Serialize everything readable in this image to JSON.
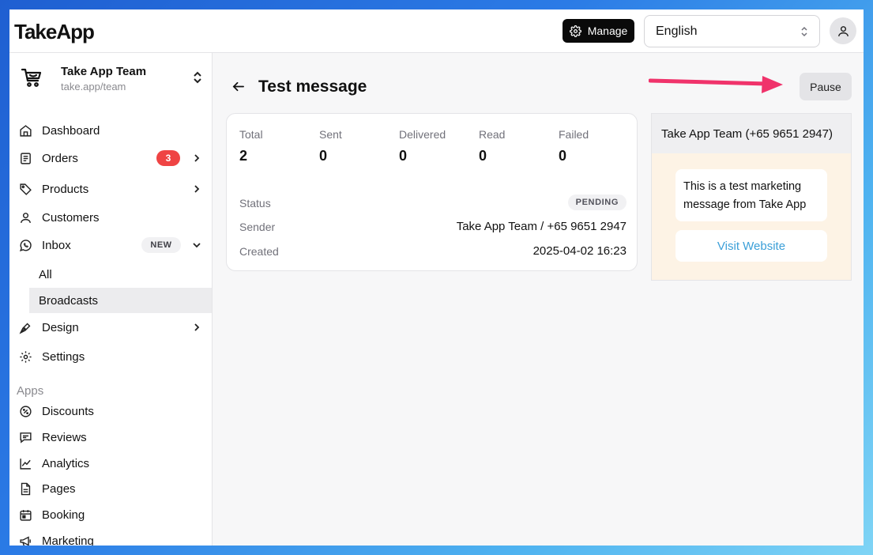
{
  "header": {
    "logo": "TakeApp",
    "manage_label": "Manage",
    "language": "English"
  },
  "sidebar": {
    "team_name": "Take App Team",
    "team_url": "take.app/team",
    "items": [
      {
        "label": "Dashboard",
        "icon": "home-icon"
      },
      {
        "label": "Orders",
        "icon": "orders-icon",
        "badge": "3"
      },
      {
        "label": "Products",
        "icon": "tag-icon"
      },
      {
        "label": "Customers",
        "icon": "user-icon"
      },
      {
        "label": "Inbox",
        "icon": "whatsapp-icon",
        "badge": "NEW"
      }
    ],
    "inbox_sub": [
      "All",
      "Broadcasts"
    ],
    "items2": [
      {
        "label": "Design",
        "icon": "pen-icon"
      },
      {
        "label": "Settings",
        "icon": "gear-icon"
      }
    ],
    "apps_label": "Apps",
    "apps": [
      {
        "label": "Discounts",
        "icon": "discount-icon"
      },
      {
        "label": "Reviews",
        "icon": "message-icon"
      },
      {
        "label": "Analytics",
        "icon": "chart-icon"
      },
      {
        "label": "Pages",
        "icon": "page-icon"
      },
      {
        "label": "Booking",
        "icon": "calendar-icon"
      },
      {
        "label": "Marketing",
        "icon": "megaphone-icon"
      }
    ]
  },
  "main": {
    "title": "Test message",
    "pause_label": "Pause",
    "stats": [
      {
        "label": "Total",
        "value": "2"
      },
      {
        "label": "Sent",
        "value": "0"
      },
      {
        "label": "Delivered",
        "value": "0"
      },
      {
        "label": "Read",
        "value": "0"
      },
      {
        "label": "Failed",
        "value": "0"
      }
    ],
    "status_label": "Status",
    "status_value": "PENDING",
    "sender_label": "Sender",
    "sender_value": "Take App Team / +65 9651 2947",
    "created_label": "Created",
    "created_value": "2025-04-02 16:23"
  },
  "preview": {
    "header": "Take App Team (+65 9651 2947)",
    "message": "This is a test marketing message from Take App",
    "button_label": "Visit Website"
  },
  "colors": {
    "badge_red": "#ef4444",
    "annotation_arrow": "#f0336b",
    "preview_bg": "#fdf3e5",
    "link": "#3b9fd8"
  }
}
